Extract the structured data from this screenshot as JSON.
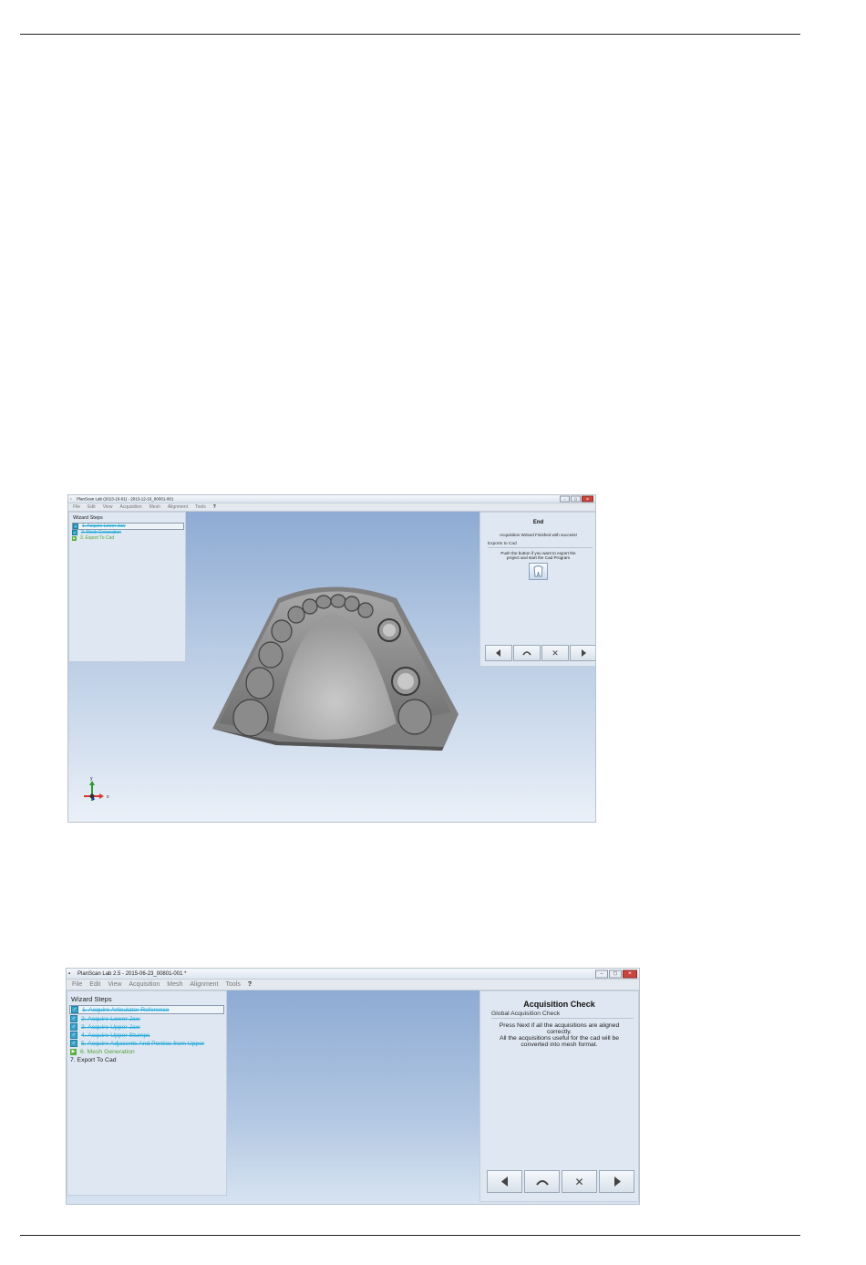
{
  "screenshot1": {
    "title": "PlanScan Lab (2013-10-01) - 2013-12-16_00001-001",
    "menu": [
      "File",
      "Edit",
      "View",
      "Acquisition",
      "Mesh",
      "Alignment",
      "Tools",
      "?"
    ],
    "wizard_title": "Wizard Steps",
    "steps": [
      {
        "label": "1. Acquire Lower Jaw",
        "state": "done"
      },
      {
        "label": "2. Mesh Generation",
        "state": "done"
      },
      {
        "label": "3. Export To Cad",
        "state": "active"
      }
    ],
    "right_title": "End",
    "right_message": "Acquisition Wizard Finished with success!",
    "section_title": "Exports to Cad",
    "section_text": "Push the button if you want to export the project and start the Cad Program",
    "axis_y": "y",
    "axis_x": "x"
  },
  "screenshot2": {
    "title": "PlanScan Lab 2.5 - 2015-06-23_00801-001 *",
    "menu": [
      "File",
      "Edit",
      "View",
      "Acquisition",
      "Mesh",
      "Alignment",
      "Tools",
      "?"
    ],
    "wizard_title": "Wizard Steps",
    "steps": [
      {
        "label": "1. Acquire Articulator Reference",
        "state": "done"
      },
      {
        "label": "2. Acquire Lower Jaw",
        "state": "done"
      },
      {
        "label": "3. Acquire Upper Jaw",
        "state": "done"
      },
      {
        "label": "4. Acquire Upper Stumps",
        "state": "done"
      },
      {
        "label": "5. Acquire Adjacents And Pontics from Upper",
        "state": "done"
      },
      {
        "label": "6. Mesh Generation",
        "state": "active"
      },
      {
        "label": "7. Export To Cad",
        "state": "pending"
      }
    ],
    "right_title": "Acquisition Check",
    "section_title": "Global Acquisition Check",
    "section_text_1": "Press Next if all the acquisitions are aligned correctly.",
    "section_text_2": "All the acquisitions useful for the cad will be converted into mesh format."
  },
  "nav_icons": [
    "back-arrow-icon",
    "undo-arc-icon",
    "cancel-x-icon",
    "next-arrow-icon"
  ],
  "colors": {
    "done_step": "#1aa6d8",
    "active_step": "#55a03b",
    "viewport_top": "#8eabd3"
  }
}
